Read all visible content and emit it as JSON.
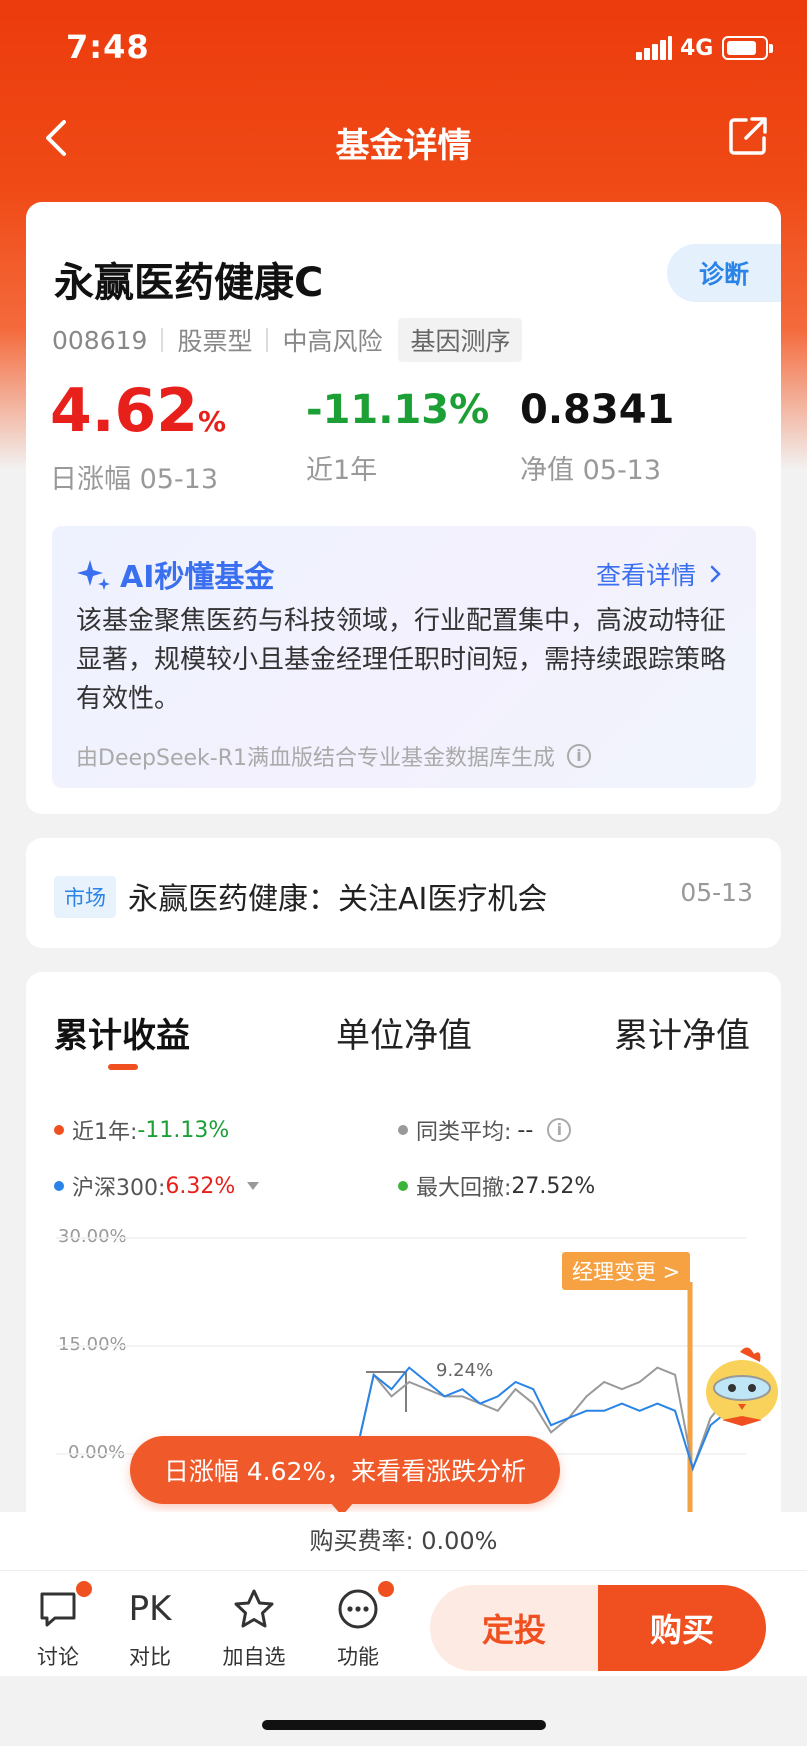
{
  "status": {
    "time": "7:48",
    "network": "4G",
    "battery_level": 0.8
  },
  "nav": {
    "title": "基金详情",
    "back_icon": "back-chevron-icon",
    "share_icon": "share-icon"
  },
  "fund": {
    "name": "永赢医药健康C",
    "diagnose_label": "诊断",
    "code": "008619",
    "type": "股票型",
    "risk": "中高风险",
    "gene_label": "基因测序",
    "daily_change_value": "4.62",
    "daily_change_unit": "%",
    "daily_change_label": "日涨幅 05-13",
    "year_change": "-11.13%",
    "year_label": "近1年",
    "nav_value": "0.8341",
    "nav_label": "净值 05-13"
  },
  "ai": {
    "title": "AI秒懂基金",
    "detail_label": "查看详情",
    "summary": "该基金聚焦医药与科技领域，行业配置集中，高波动特征显著，规模较小且基金经理任职时间短，需持续跟踪策略有效性。",
    "footer": "由DeepSeek-R1满血版结合专业基金数据库生成"
  },
  "news": {
    "tag": "市场",
    "title": "永赢医药健康：关注AI医疗机会",
    "date": "05-13"
  },
  "chart": {
    "tabs": [
      "累计收益",
      "单位净值",
      "累计净值"
    ],
    "active_tab": 0,
    "legend": {
      "fund": {
        "label": "近1年:",
        "value": "-11.13%",
        "color": "#f0501f"
      },
      "peer": {
        "label": "同类平均:",
        "value": "--",
        "color": "#999999"
      },
      "index": {
        "label": "沪深300:",
        "value": "6.32%",
        "color": "#2a83e6"
      },
      "drawdown": {
        "label": "最大回撤:",
        "value": "27.52%",
        "color": "#3cb43c"
      }
    },
    "y_ticks": [
      "30.00%",
      "15.00%",
      "0.00%"
    ],
    "crosshair_label": "9.24%",
    "manager_change_label": "经理变更 >"
  },
  "chart_data": {
    "type": "line",
    "ylim": [
      -10,
      30
    ],
    "ytick_labels": [
      "30.00%",
      "15.00%",
      "0.00%"
    ],
    "series": [
      {
        "name": "沪深300",
        "color": "#2a83e6",
        "values": [
          0,
          11,
          9,
          12,
          10,
          8,
          9,
          7,
          8,
          10,
          9,
          4,
          5,
          6,
          6,
          7,
          6,
          7,
          6,
          -2,
          4,
          6,
          7
        ]
      },
      {
        "name": "同类平均",
        "color": "#999999",
        "values": [
          0,
          11,
          8,
          10,
          9,
          8,
          8,
          7,
          6,
          9,
          7,
          3,
          5,
          8,
          10,
          9,
          10,
          12,
          11,
          -2,
          5,
          8,
          9
        ]
      }
    ]
  },
  "toast": {
    "text": "日涨幅 4.62%，来看看涨跌分析"
  },
  "fee": {
    "text": "购买费率: 0.00%"
  },
  "bottom": {
    "discuss": "讨论",
    "pk_icon_text": "PK",
    "compare": "对比",
    "watch": "加自选",
    "function": "功能",
    "dingtou": "定投",
    "buy": "购买"
  }
}
